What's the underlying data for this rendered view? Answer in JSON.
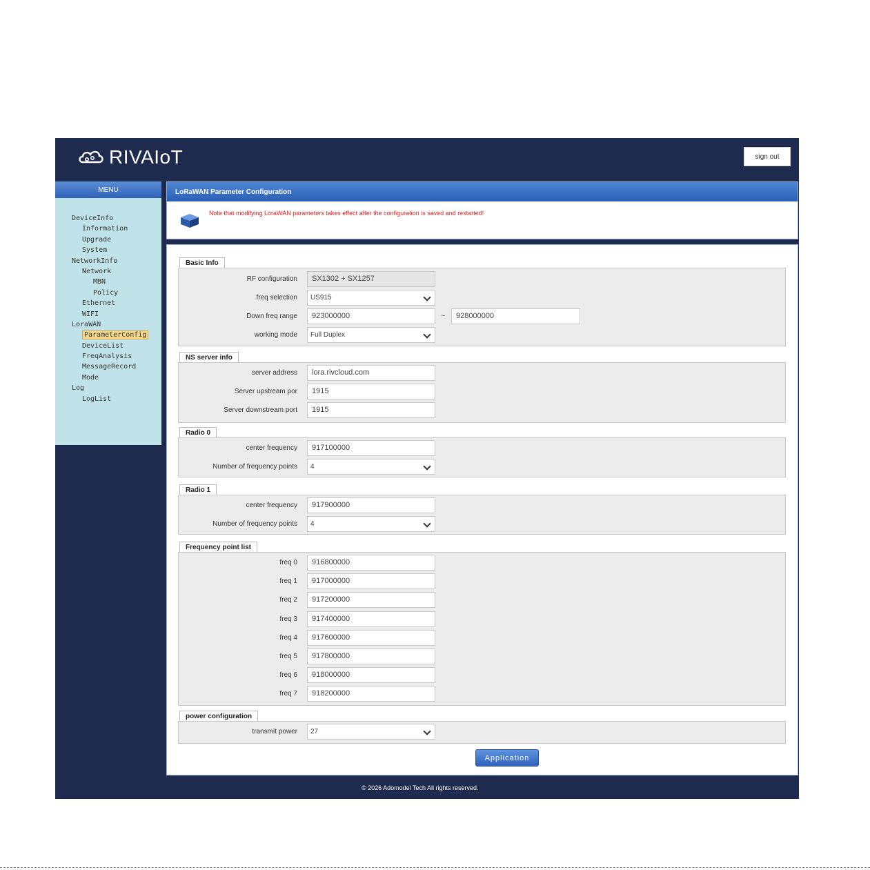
{
  "header": {
    "brand": "RIVAIoT",
    "signout_label": "sign out"
  },
  "sidebar": {
    "menu_title": "MENU",
    "items": [
      {
        "label": "DeviceInfo",
        "level": 0
      },
      {
        "label": "Information",
        "level": 1
      },
      {
        "label": "Upgrade",
        "level": 1
      },
      {
        "label": "System",
        "level": 1
      },
      {
        "label": "NetworkInfo",
        "level": 0
      },
      {
        "label": "Network",
        "level": 1
      },
      {
        "label": "MBN",
        "level": 2
      },
      {
        "label": "Policy",
        "level": 2
      },
      {
        "label": "Ethernet",
        "level": 1
      },
      {
        "label": "WIFI",
        "level": 1
      },
      {
        "label": "LoraWAN",
        "level": 0
      },
      {
        "label": "ParameterConfig",
        "level": 1,
        "active": true
      },
      {
        "label": "DeviceList",
        "level": 1
      },
      {
        "label": "FreqAnalysis",
        "level": 1
      },
      {
        "label": "MessageRecord",
        "level": 1
      },
      {
        "label": "Mode",
        "level": 1
      },
      {
        "label": "Log",
        "level": 0
      },
      {
        "label": "LogList",
        "level": 1
      }
    ]
  },
  "panel": {
    "title": "LoRaWAN Parameter Configuration",
    "note": "Note that modifying LoraWAN parameters takes effect after the configuration is saved and restarted!"
  },
  "basic_info": {
    "title": "Basic Info",
    "rf_label": "RF configuration",
    "rf_value": "SX1302 + SX1257",
    "freq_sel_label": "freq selection",
    "freq_sel_value": "US915",
    "down_label": "Down freq range",
    "down_min": "923000000",
    "down_sep": "~",
    "down_max": "928000000",
    "mode_label": "working mode",
    "mode_value": "Full Duplex"
  },
  "ns_server": {
    "title": "NS server info",
    "addr_label": "server address",
    "addr_value": "lora.rivcloud.com",
    "up_label": "Server upstream por",
    "up_value": "1915",
    "down_label": "Server downstream port",
    "down_value": "1915"
  },
  "radio0": {
    "title": "Radio 0",
    "cf_label": "center frequency",
    "cf_value": "917100000",
    "np_label": "Number of frequency points",
    "np_value": "4"
  },
  "radio1": {
    "title": "Radio 1",
    "cf_label": "center frequency",
    "cf_value": "917900000",
    "np_label": "Number of frequency points",
    "np_value": "4"
  },
  "freq_list": {
    "title": "Frequency point list",
    "items": [
      {
        "label": "freq 0",
        "value": "916800000"
      },
      {
        "label": "freq 1",
        "value": "917000000"
      },
      {
        "label": "freq 2",
        "value": "917200000"
      },
      {
        "label": "freq 3",
        "value": "917400000"
      },
      {
        "label": "freq 4",
        "value": "917600000"
      },
      {
        "label": "freq 5",
        "value": "917800000"
      },
      {
        "label": "freq 6",
        "value": "918000000"
      },
      {
        "label": "freq 7",
        "value": "918200000"
      }
    ]
  },
  "power": {
    "title": "power configuration",
    "tx_label": "transmit power",
    "tx_value": "27"
  },
  "apply_label": "Application",
  "footer": "© 2026 Adomodel Tech All rights reserved.",
  "colors": {
    "background": "#1e2a4e",
    "sidebar": "#bfe3e8",
    "accent": "#2f62b8",
    "note": "#e02020"
  }
}
